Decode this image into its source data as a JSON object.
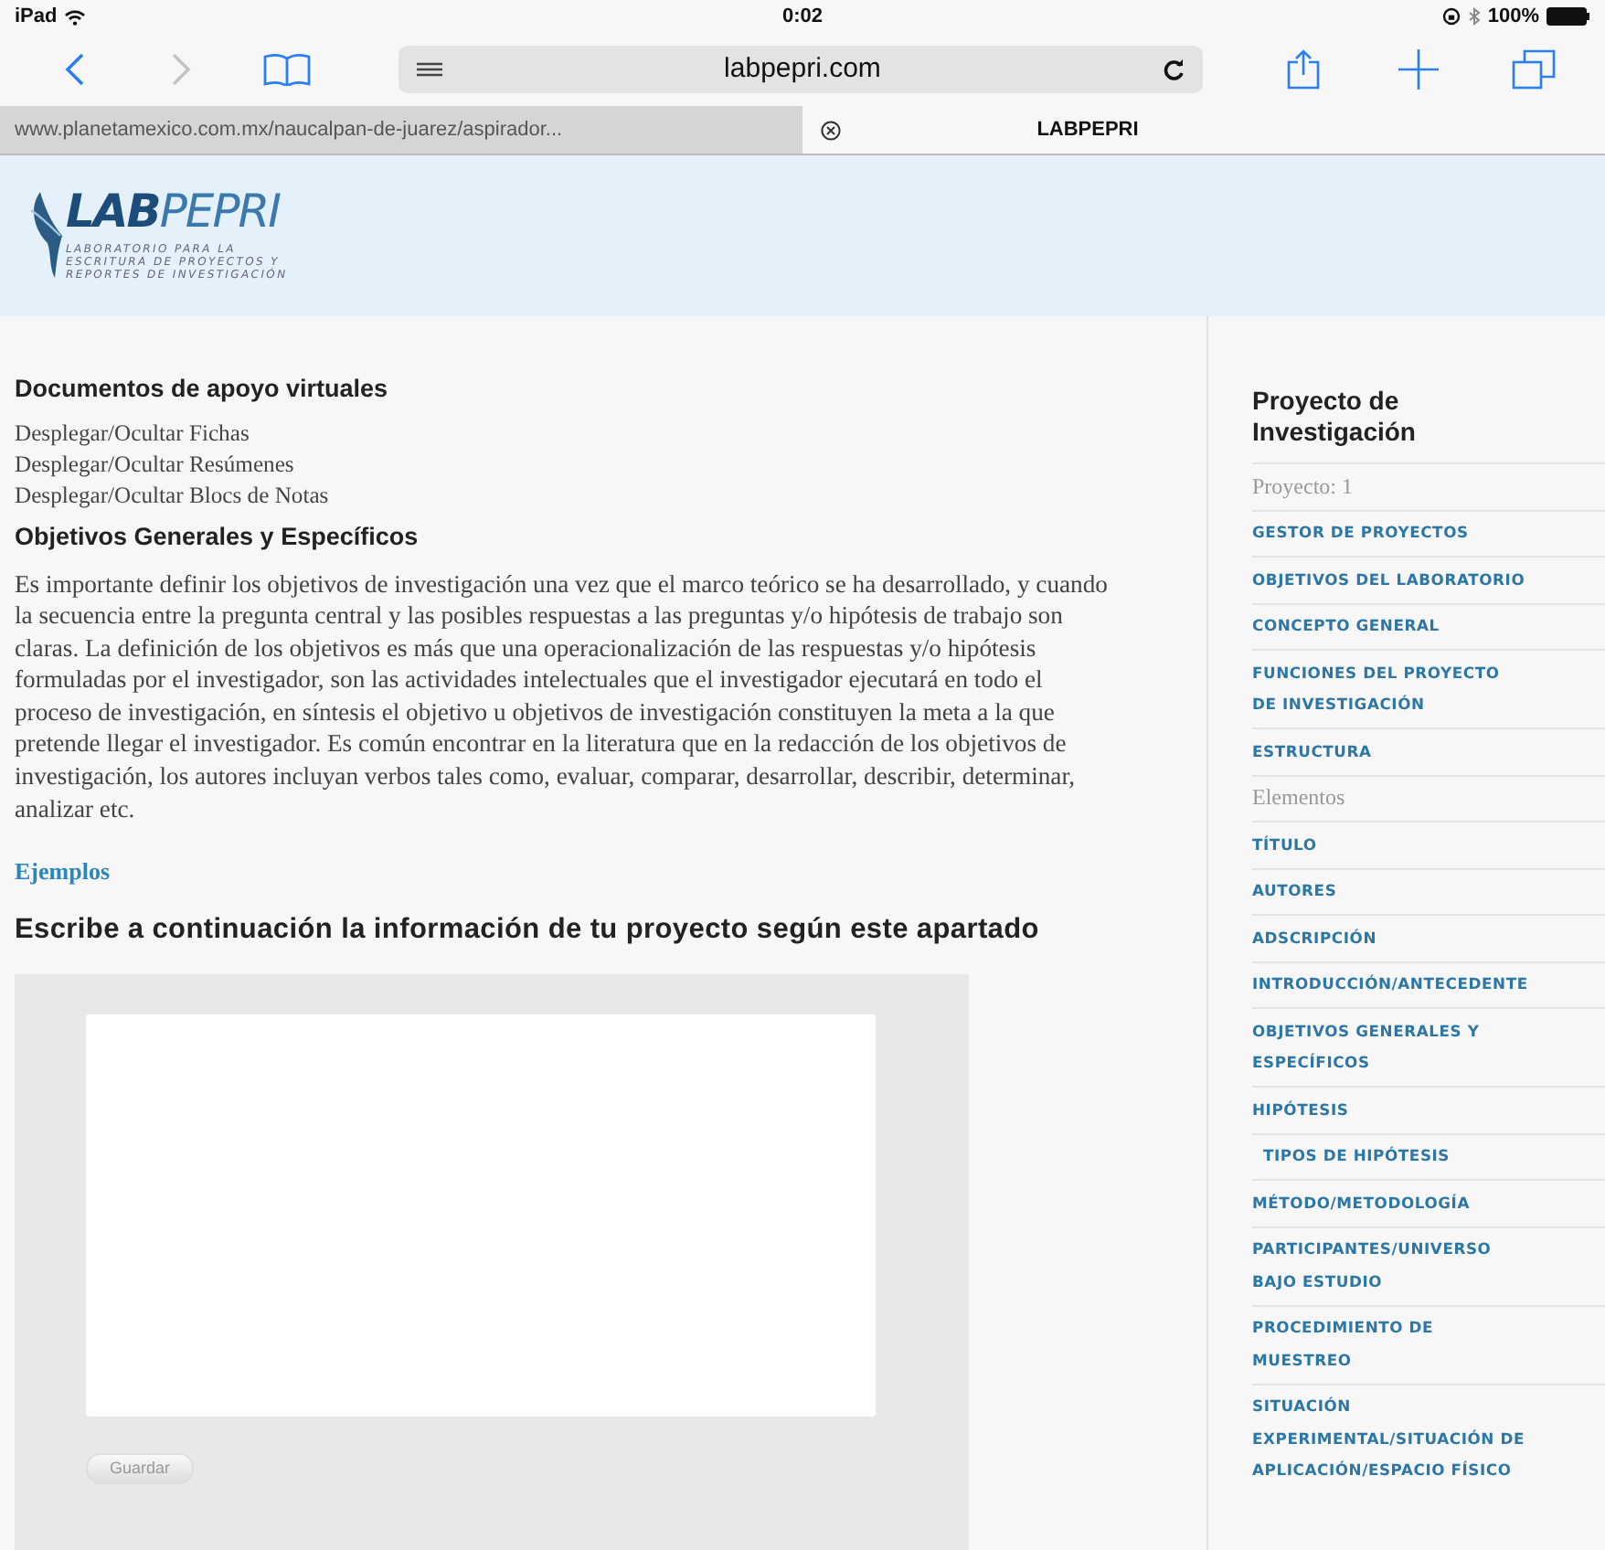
{
  "status_bar": {
    "device": "iPad",
    "time": "0:02",
    "battery": "100%"
  },
  "toolbar": {
    "buttons": [
      {
        "kind": "back",
        "disabled": false
      },
      {
        "kind": "forward",
        "disabled": true
      },
      {
        "kind": "bookmarks",
        "disabled": false
      }
    ],
    "address": "labpepri.com",
    "actions": [
      {
        "kind": "share"
      },
      {
        "kind": "add"
      },
      {
        "kind": "tabs"
      }
    ]
  },
  "tabs": [
    {
      "label": "www.planetamexico.com.mx/naucalpan-de-juarez/aspirador...",
      "selected": false
    },
    {
      "label": "LABPEPRI",
      "selected": true
    }
  ],
  "logo": {
    "title_a": "LAB",
    "title_b": "PEPRI",
    "subtitle": [
      "LABORATORIO PARA LA",
      "ESCRITURA DE PROYECTOS Y",
      "REPORTES DE INVESTIGACIÓN"
    ]
  },
  "main": {
    "docs_heading": "Documentos de apoyo virtuales",
    "docs_links": [
      "Desplegar/Ocultar Fichas",
      "Desplegar/Ocultar Resúmenes",
      "Desplegar/Ocultar Blocs de Notas"
    ],
    "section_heading": "Objetivos Generales y Específicos",
    "paragraph": "Es importante definir los objetivos de investigación una vez que el marco teórico se ha desarrollado, y cuando la secuencia entre la pregunta central y las posibles respuestas a las preguntas y/o hipótesis de trabajo son claras. La definición de los objetivos es más que una operacionalización de las respuestas y/o hipótesis formuladas por el investigador, son las actividades intelectuales que el investigador ejecutará en todo el proceso de investigación, en síntesis el objetivo u objetivos de investigación constituyen la meta a la que pretende llegar el investigador. Es común encontrar en la literatura que en la redacción de los objetivos de investigación, los autores incluyan verbos tales como, evaluar, comparar, desarrollar, describir, determinar, analizar etc.",
    "examples_link": "Ejemplos",
    "write_heading": "Escribe a continuación la información de tu proyecto según este apartado",
    "save_button": "Guardar"
  },
  "sidebar": {
    "title": "Proyecto de Investigación",
    "items": [
      {
        "kind": "label",
        "text": "Proyecto: 1"
      },
      {
        "kind": "link",
        "text": "GESTOR DE PROYECTOS"
      },
      {
        "kind": "link",
        "text": "OBJETIVOS DEL LABORATORIO"
      },
      {
        "kind": "link",
        "text": "CONCEPTO GENERAL"
      },
      {
        "kind": "link",
        "text": "FUNCIONES DEL PROYECTO DE INVESTIGACIÓN"
      },
      {
        "kind": "link",
        "text": "ESTRUCTURA"
      },
      {
        "kind": "label",
        "text": "Elementos"
      },
      {
        "kind": "link",
        "text": "TÍTULO"
      },
      {
        "kind": "link",
        "text": "AUTORES"
      },
      {
        "kind": "link",
        "text": "ADSCRIPCIÓN"
      },
      {
        "kind": "link",
        "text": "INTRODUCCIÓN/ANTECEDENTE"
      },
      {
        "kind": "link",
        "text": "OBJETIVOS GENERALES Y ESPECÍFICOS"
      },
      {
        "kind": "link",
        "text": "HIPÓTESIS",
        "children": [
          {
            "kind": "link",
            "text": "TIPOS DE HIPÓTESIS"
          }
        ]
      },
      {
        "kind": "link",
        "text": "MÉTODO/METODOLOGÍA"
      },
      {
        "kind": "link",
        "text": "PARTICIPANTES/UNIVERSO BAJO ESTUDIO"
      },
      {
        "kind": "link",
        "text": "PROCEDIMIENTO DE MUESTREO"
      },
      {
        "kind": "link",
        "text": "SITUACIÓN EXPERIMENTAL/SITUACIÓN DE APLICACIÓN/ESPACIO FÍSICO"
      }
    ]
  }
}
